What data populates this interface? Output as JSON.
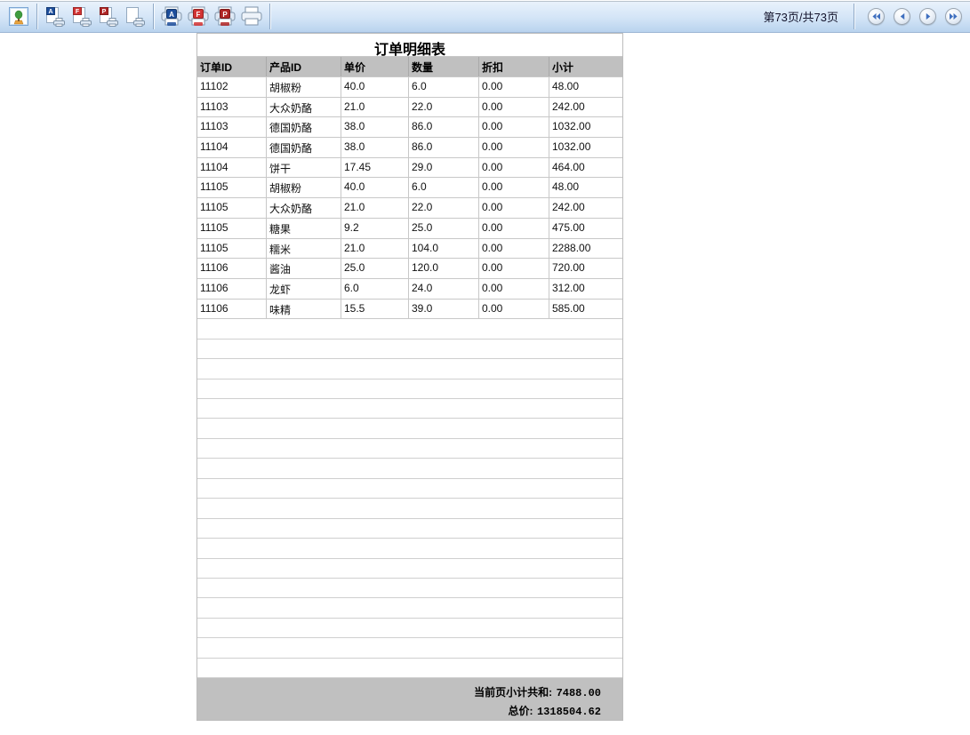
{
  "toolbar": {
    "page_label": "第73页/共73页",
    "logo_button": {
      "icon": "image-icon"
    },
    "preview_buttons": [
      {
        "name": "print-preview-applet",
        "letter": "A",
        "icon": "page-print-icon"
      },
      {
        "name": "print-preview-flash",
        "letter": "F",
        "icon": "page-print-icon"
      },
      {
        "name": "print-preview-pdf",
        "letter": "P",
        "icon": "page-print-icon"
      },
      {
        "name": "print-preview-plain",
        "letter": "",
        "icon": "page-print-icon"
      }
    ],
    "print_buttons": [
      {
        "name": "print-applet",
        "letter": "A",
        "icon": "printer-icon"
      },
      {
        "name": "print-flash",
        "letter": "F",
        "icon": "printer-icon"
      },
      {
        "name": "print-pdf",
        "letter": "P",
        "icon": "printer-icon"
      },
      {
        "name": "print-plain",
        "letter": "",
        "icon": "printer-icon"
      }
    ],
    "nav_buttons": [
      {
        "name": "first-page",
        "icon": "double-arrow-left-icon"
      },
      {
        "name": "previous-page",
        "icon": "arrow-left-icon"
      },
      {
        "name": "next-page",
        "icon": "arrow-right-icon"
      },
      {
        "name": "last-page",
        "icon": "double-arrow-right-icon"
      }
    ]
  },
  "report": {
    "title": "订单明细表",
    "columns": [
      "订单ID",
      "产品ID",
      "单价",
      "数量",
      "折扣",
      "小计"
    ],
    "rows": [
      [
        "11102",
        "胡椒粉",
        "40.0",
        "6.0",
        "0.00",
        "48.00"
      ],
      [
        "11103",
        "大众奶酪",
        "21.0",
        "22.0",
        "0.00",
        "242.00"
      ],
      [
        "11103",
        "德国奶酪",
        "38.0",
        "86.0",
        "0.00",
        "1032.00"
      ],
      [
        "11104",
        "德国奶酪",
        "38.0",
        "86.0",
        "0.00",
        "1032.00"
      ],
      [
        "11104",
        "饼干",
        "17.45",
        "29.0",
        "0.00",
        "464.00"
      ],
      [
        "11105",
        "胡椒粉",
        "40.0",
        "6.0",
        "0.00",
        "48.00"
      ],
      [
        "11105",
        "大众奶酪",
        "21.0",
        "22.0",
        "0.00",
        "242.00"
      ],
      [
        "11105",
        "糖果",
        "9.2",
        "25.0",
        "0.00",
        "475.00"
      ],
      [
        "11105",
        "糯米",
        "21.0",
        "104.0",
        "0.00",
        "2288.00"
      ],
      [
        "11106",
        "酱油",
        "25.0",
        "120.0",
        "0.00",
        "720.00"
      ],
      [
        "11106",
        "龙虾",
        "6.0",
        "24.0",
        "0.00",
        "312.00"
      ],
      [
        "11106",
        "味精",
        "15.5",
        "39.0",
        "0.00",
        "585.00"
      ]
    ],
    "empty_row_count": 18,
    "footer": {
      "subtotal_label": "当前页小计共和:",
      "subtotal_value": "7488.00",
      "total_label": "总价:",
      "total_value": "1318504.62"
    }
  },
  "colors": {
    "applet_blue": "#1e4f9c",
    "flash_red": "#d23333",
    "pdf_red": "#b02525",
    "header_bg": "#c0c0c0",
    "footer_bg": "#c0c0c0",
    "grid_gray": "#c8c8c8",
    "toolbar_blue_top": "#ebf3fc",
    "toolbar_blue_bottom": "#b9d3ee",
    "nav_arrow_blue": "#3f6fbf"
  }
}
